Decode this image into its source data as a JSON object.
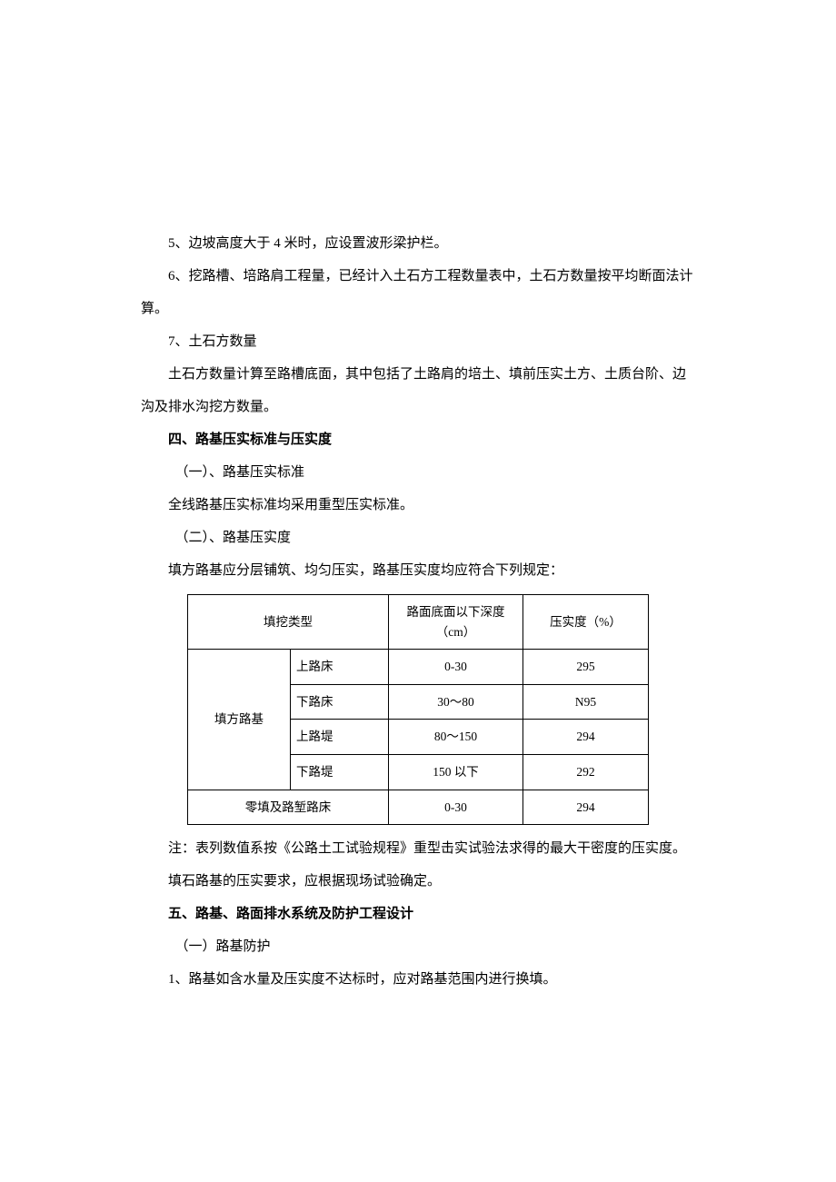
{
  "p1": "5、边坡高度大于 4 米时，应设置波形梁护栏。",
  "p2": "6、挖路槽、培路肩工程量，已经计入土石方工程数量表中，土石方数量按平均断面法计算。",
  "p3": "7、土石方数量",
  "p4": "土石方数量计算至路槽底面，其中包括了土路肩的培土、填前压实土方、土质台阶、边沟及排水沟挖方数量。",
  "h4": "四、路基压实标准与压实度",
  "p5": "（一）、路基压实标准",
  "p6": "全线路基压实标准均采用重型压实标准。",
  "p7": "（二）、路基压实度",
  "p8": "填方路基应分层铺筑、均匀压实，路基压实度均应符合下列规定：",
  "table": {
    "head": {
      "c1": "填挖类型",
      "c2": "路面底面以下深度（cm）",
      "c3": "压实度（%）"
    },
    "group1": {
      "label": "填方路基",
      "rows": [
        {
          "sub": "上路床",
          "depth": "0-30",
          "deg": "295"
        },
        {
          "sub": "下路床",
          "depth": "30～80",
          "deg": "N95"
        },
        {
          "sub": "上路堤",
          "depth": "80～150",
          "deg": "294"
        },
        {
          "sub": "下路堤",
          "depth": "150 以下",
          "deg": "292"
        }
      ]
    },
    "group2": {
      "label": "零填及路堑路床",
      "depth": "0-30",
      "deg": "294"
    }
  },
  "p9": "注：表列数值系按《公路土工试验规程》重型击实试验法求得的最大干密度的压实度。",
  "p10": "填石路基的压实要求，应根据现场试验确定。",
  "h5": "五、路基、路面排水系统及防护工程设计",
  "p11": "（一）路基防护",
  "p12": "1、路基如含水量及压实度不达标时，应对路基范围内进行换填。"
}
